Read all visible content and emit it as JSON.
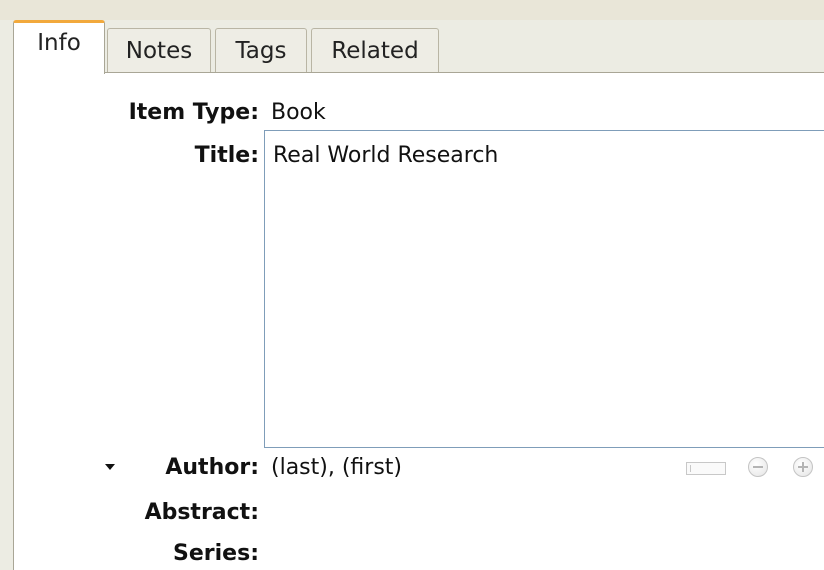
{
  "tabs": [
    {
      "label": "Info",
      "selected": true
    },
    {
      "label": "Notes",
      "selected": false
    },
    {
      "label": "Tags",
      "selected": false
    },
    {
      "label": "Related",
      "selected": false
    }
  ],
  "fields": {
    "item_type": {
      "label": "Item Type:",
      "value": "Book"
    },
    "title": {
      "label": "Title:",
      "value": "Real World Research"
    },
    "author": {
      "label": "Author:",
      "value": "(last), (first)"
    },
    "abstract": {
      "label": "Abstract:"
    },
    "series": {
      "label": "Series:"
    }
  },
  "icons": {
    "expand_toggle": "triangle-down-icon",
    "mode_switch": "field-mode-switch-icon",
    "remove": "minus-circle-icon",
    "add": "plus-circle-icon"
  },
  "colors": {
    "selected_tab_accent": "#f2a93c",
    "input_border": "#7f9db9",
    "window_background": "#ecece3"
  }
}
